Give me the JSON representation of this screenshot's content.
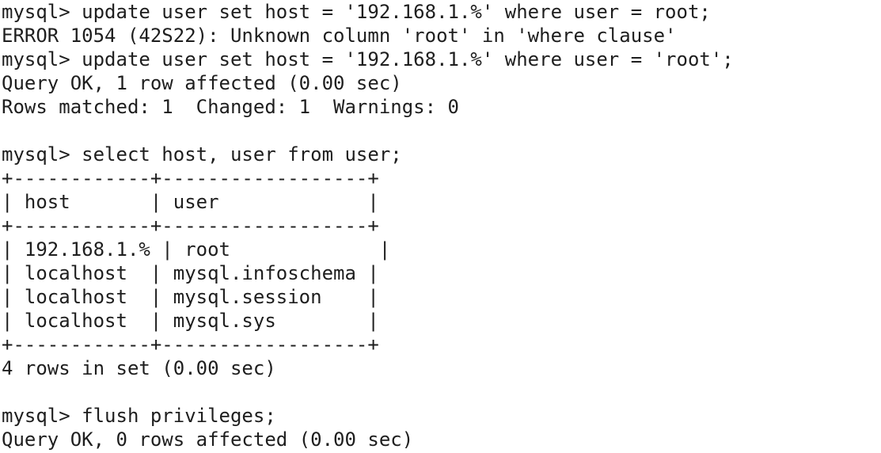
{
  "terminal": {
    "lines": [
      "mysql> update user set host = '192.168.1.%' where user = root;",
      "ERROR 1054 (42S22): Unknown column 'root' in 'where clause'",
      "mysql> update user set host = '192.168.1.%' where user = 'root';",
      "Query OK, 1 row affected (0.00 sec)",
      "Rows matched: 1  Changed: 1  Warnings: 0",
      "",
      "mysql> select host, user from user;",
      "+------------+------------------+",
      "| host       | user             |",
      "+------------+------------------+",
      "| 192.168.1.% | root             |",
      "| localhost  | mysql.infoschema |",
      "| localhost  | mysql.session    |",
      "| localhost  | mysql.sys        |",
      "+------------+------------------+",
      "4 rows in set (0.00 sec)",
      "",
      "mysql> flush privileges;",
      "Query OK, 0 rows affected (0.00 sec)"
    ]
  }
}
